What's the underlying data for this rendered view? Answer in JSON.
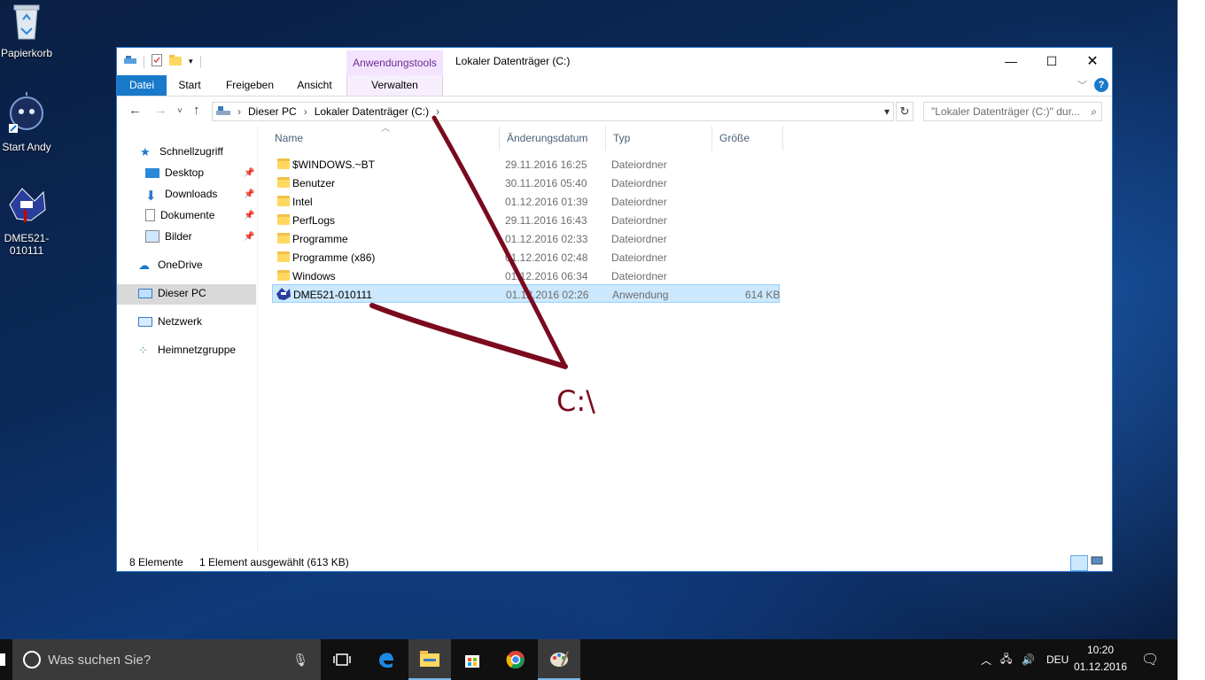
{
  "desktop": {
    "icons": [
      {
        "label": "Papierkorb"
      },
      {
        "label": "Start Andy"
      },
      {
        "label": "DME521-010111"
      }
    ]
  },
  "window": {
    "title": "Lokaler Datenträger (C:)",
    "contextual_tab_group": "Anwendungstools",
    "ribbon_tabs": [
      "Datei",
      "Start",
      "Freigeben",
      "Ansicht",
      "Verwalten"
    ],
    "breadcrumb": [
      "Dieser PC",
      "Lokaler Datenträger (C:)"
    ],
    "search_placeholder": "\"Lokaler Datenträger (C:)\" dur...",
    "nav_pane": {
      "quick_access": "Schnellzugriff",
      "items": [
        {
          "label": "Desktop",
          "pinned": true
        },
        {
          "label": "Downloads",
          "pinned": true
        },
        {
          "label": "Dokumente",
          "pinned": true
        },
        {
          "label": "Bilder",
          "pinned": true
        }
      ],
      "onedrive": "OneDrive",
      "this_pc": "Dieser PC",
      "network": "Netzwerk",
      "homegroup": "Heimnetzgruppe"
    },
    "columns": [
      "Name",
      "Änderungsdatum",
      "Typ",
      "Größe"
    ],
    "files": [
      {
        "name": "$WINDOWS.~BT",
        "date": "29.11.2016 16:25",
        "type": "Dateiordner",
        "size": ""
      },
      {
        "name": "Benutzer",
        "date": "30.11.2016 05:40",
        "type": "Dateiordner",
        "size": ""
      },
      {
        "name": "Intel",
        "date": "01.12.2016 01:39",
        "type": "Dateiordner",
        "size": ""
      },
      {
        "name": "PerfLogs",
        "date": "29.11.2016 16:43",
        "type": "Dateiordner",
        "size": ""
      },
      {
        "name": "Programme",
        "date": "01.12.2016 02:33",
        "type": "Dateiordner",
        "size": ""
      },
      {
        "name": "Programme (x86)",
        "date": "01.12.2016 02:48",
        "type": "Dateiordner",
        "size": ""
      },
      {
        "name": "Windows",
        "date": "01.12.2016 06:34",
        "type": "Dateiordner",
        "size": ""
      },
      {
        "name": "DME521-010111",
        "date": "01.12.2016 02:26",
        "type": "Anwendung",
        "size": "614 KB",
        "selected": true
      }
    ],
    "status": {
      "count": "8 Elemente",
      "selection": "1 Element ausgewählt (613 KB)"
    }
  },
  "annotation": {
    "label": "C:\\",
    "color": "#7a0a1e"
  },
  "taskbar": {
    "search_placeholder": "Was suchen Sie?",
    "apps": [
      "task-view",
      "edge",
      "file-explorer",
      "store",
      "chrome",
      "paint"
    ],
    "language": "DEU",
    "time": "10:20",
    "date": "01.12.2016"
  },
  "colors": {
    "accent": "#1979ca",
    "selection": "#cce8ff",
    "contextual": "#6b2c91"
  }
}
